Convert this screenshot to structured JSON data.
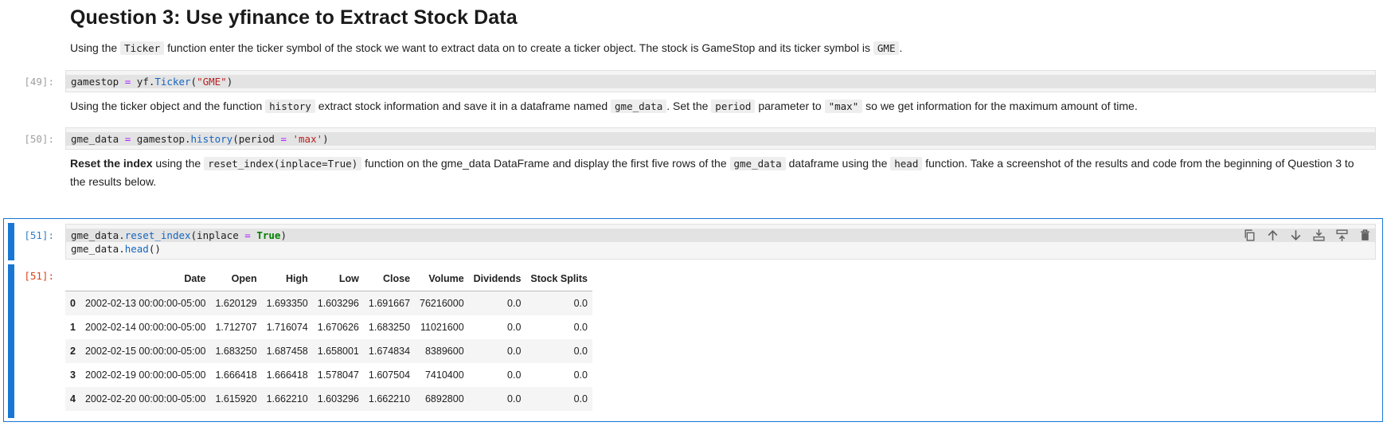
{
  "heading": "Question 3: Use yfinance to Extract Stock Data",
  "md1": {
    "p1": "Using the ",
    "c1": "Ticker",
    "p2": " function enter the ticker symbol of the stock we want to extract data on to create a ticker object. The stock is GameStop and its ticker symbol is ",
    "c2": "GME",
    "p3": "."
  },
  "cell49": {
    "prompt": "[49]:",
    "t1": "gamestop ",
    "op": "=",
    "t2": " yf.",
    "fn": "Ticker",
    "t3": "(",
    "str": "\"GME\"",
    "t4": ")"
  },
  "md2": {
    "p1": "Using the ticker object and the function ",
    "c1": "history",
    "p2": " extract stock information and save it in a dataframe named ",
    "c2": "gme_data",
    "p3": ". Set the ",
    "c3": "period",
    "p4": " parameter to ",
    "c4": "\"max\"",
    "p5": " so we get information for the maximum amount of time."
  },
  "cell50": {
    "prompt": "[50]:",
    "t1": "gme_data ",
    "op": "=",
    "t2": " gamestop.",
    "fn": "history",
    "t3": "(period ",
    "op2": "=",
    "t4": " ",
    "str": "'max'",
    "t5": ")"
  },
  "md3": {
    "bold": "Reset the index",
    "p1": " using the ",
    "c1": "reset_index(inplace=True)",
    "p2": " function on the gme_data DataFrame and display the first five rows of the ",
    "c2": "gme_data",
    "p3": " dataframe using the ",
    "c3": "head",
    "p4": " function. Take a screenshot of the results and code from the beginning of Question 3 to",
    "p5": "the results below."
  },
  "cell51": {
    "prompt": "[51]:",
    "out_prompt": "[51]:",
    "l1_t1": "gme_data.",
    "l1_fn": "reset_index",
    "l1_t2": "(inplace ",
    "l1_op": "=",
    "l1_t3": " ",
    "l1_kw": "True",
    "l1_t4": ")",
    "l2_t1": "gme_data.",
    "l2_fn": "head",
    "l2_t2": "()"
  },
  "toolbar_icons": [
    "copy-icon",
    "move-up-icon",
    "move-down-icon",
    "insert-above-icon",
    "insert-below-icon",
    "delete-icon"
  ],
  "table": {
    "columns": [
      "",
      "Date",
      "Open",
      "High",
      "Low",
      "Close",
      "Volume",
      "Dividends",
      "Stock Splits"
    ],
    "rows": [
      [
        "0",
        "2002-02-13 00:00:00-05:00",
        "1.620129",
        "1.693350",
        "1.603296",
        "1.691667",
        "76216000",
        "0.0",
        "0.0"
      ],
      [
        "1",
        "2002-02-14 00:00:00-05:00",
        "1.712707",
        "1.716074",
        "1.670626",
        "1.683250",
        "11021600",
        "0.0",
        "0.0"
      ],
      [
        "2",
        "2002-02-15 00:00:00-05:00",
        "1.683250",
        "1.687458",
        "1.658001",
        "1.674834",
        "8389600",
        "0.0",
        "0.0"
      ],
      [
        "3",
        "2002-02-19 00:00:00-05:00",
        "1.666418",
        "1.666418",
        "1.578047",
        "1.607504",
        "7410400",
        "0.0",
        "0.0"
      ],
      [
        "4",
        "2002-02-20 00:00:00-05:00",
        "1.615920",
        "1.662210",
        "1.603296",
        "1.662210",
        "6892800",
        "0.0",
        "0.0"
      ]
    ]
  },
  "colors": {
    "accent": "#1976d2",
    "out_prompt": "#d84315",
    "string": "#ba2121",
    "function": "#1565c0",
    "keyword": "#008000"
  }
}
